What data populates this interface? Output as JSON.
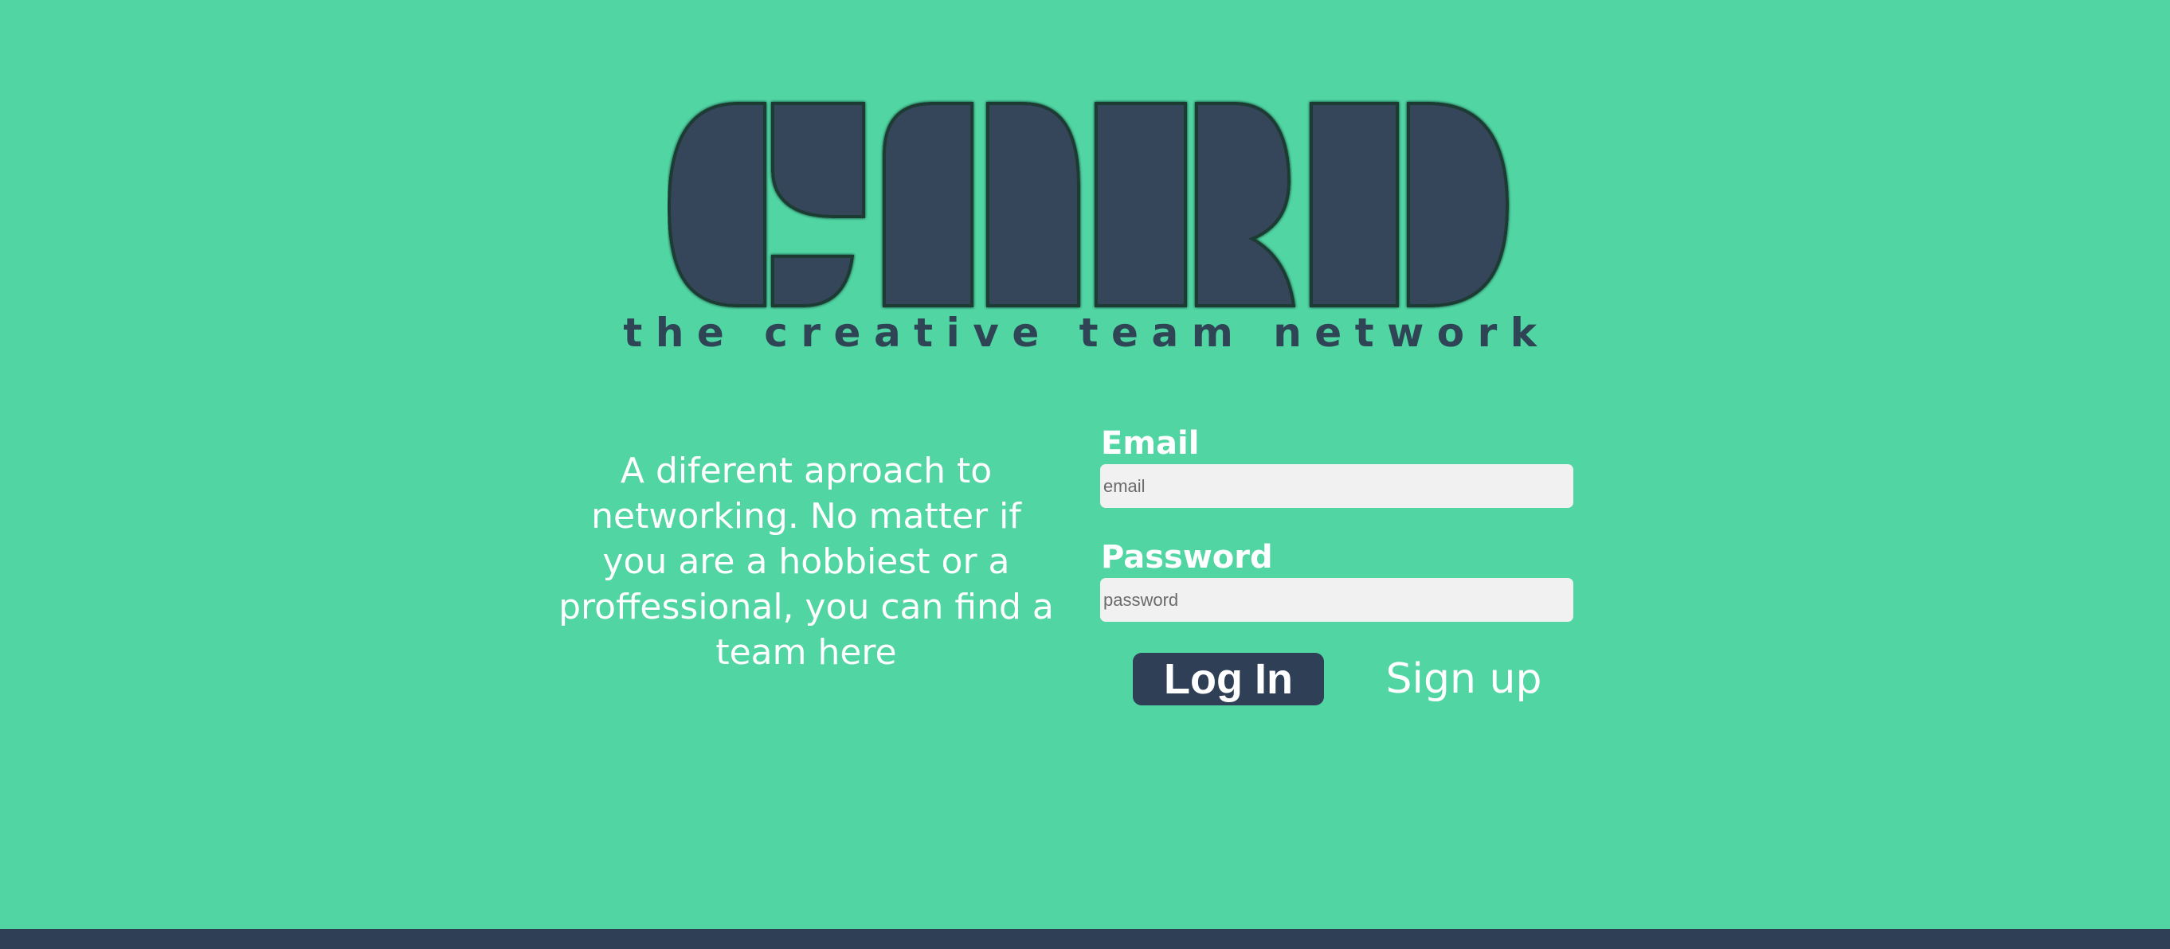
{
  "brand": {
    "logo_text": "CNRD",
    "tagline": "the creative team network"
  },
  "pitch": "A diferent aproach to networking. No matter if you are a hobbiest or a proffessional, you can find a team here",
  "login_form": {
    "email_label": "Email",
    "email_placeholder": "email",
    "password_label": "Password",
    "password_placeholder": "password",
    "login_button": "Log In",
    "signup_link": "Sign up"
  },
  "colors": {
    "background": "#50d5a3",
    "brand_dark": "#2f3f56",
    "text_light": "#ffffff",
    "input_bg": "#f1f1f1"
  }
}
